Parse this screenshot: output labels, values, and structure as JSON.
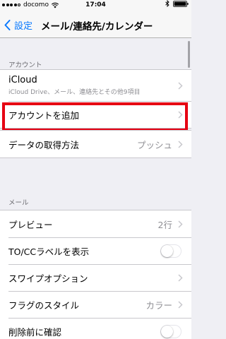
{
  "status_bar": {
    "carrier": "docomo",
    "time": "17:04"
  },
  "nav": {
    "back_label": "設定",
    "title": "メール/連絡先/カレンダー"
  },
  "accounts_section": {
    "header": "アカウント",
    "icloud_title": "iCloud",
    "icloud_subtitle": "iCloud Drive、メール、連絡先とその他9項目",
    "add_account_label": "アカウントを追加"
  },
  "fetch": {
    "label": "データの取得方法",
    "value": "プッシュ"
  },
  "mail_section": {
    "header": "メール",
    "preview_label": "プレビュー",
    "preview_value": "2行",
    "to_cc_label": "TO/CCラベルを表示",
    "to_cc_on": false,
    "swipe_label": "スワイプオプション",
    "flag_label": "フラグのスタイル",
    "flag_value": "カラー",
    "confirm_delete_label": "削除前に確認",
    "confirm_delete_on": false
  },
  "colors": {
    "accent": "#0a7aff",
    "highlight": "#e60012"
  }
}
